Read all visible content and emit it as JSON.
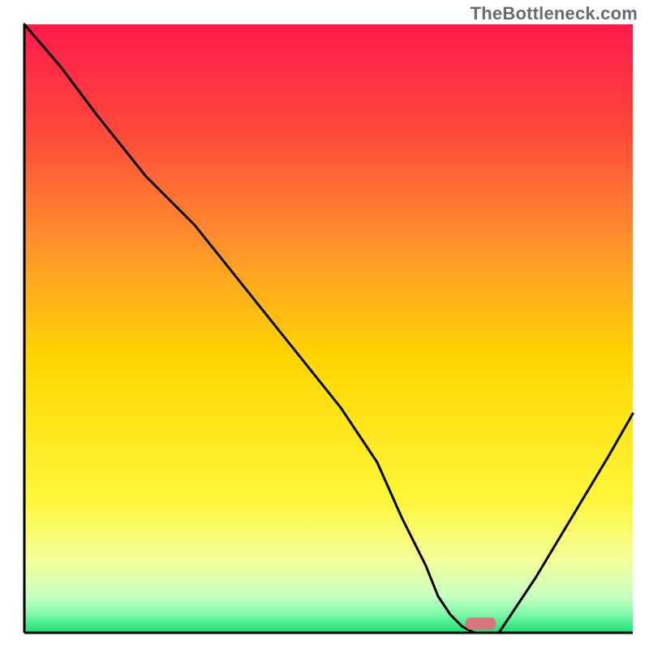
{
  "watermark": "TheBottleneck.com",
  "chart_data": {
    "type": "line",
    "title": "",
    "xlabel": "",
    "ylabel": "",
    "xlim": [
      0,
      100
    ],
    "ylim": [
      0,
      100
    ],
    "grid": false,
    "legend": false,
    "background_gradient": {
      "top": "#ff1a4c",
      "upper_mid": "#ff7a2e",
      "mid": "#ffd600",
      "lower_mid": "#f7ff6e",
      "green_band_top": "#d8ffcf",
      "bottom": "#15e06e"
    },
    "x": [
      0,
      6,
      12,
      20,
      28,
      36,
      44,
      52,
      58,
      62,
      66,
      68,
      70,
      72,
      74,
      78,
      84,
      90,
      96,
      100
    ],
    "values": [
      100,
      93,
      85,
      75,
      67,
      57,
      47,
      37,
      28,
      19,
      11,
      6,
      3,
      1,
      0,
      0,
      9,
      19,
      29,
      36
    ],
    "marker": {
      "x": 72.5,
      "y": 0.5,
      "width": 5,
      "height": 2,
      "color": "#d87680"
    },
    "axis_color": "#000000",
    "curve_color": "#000000"
  }
}
